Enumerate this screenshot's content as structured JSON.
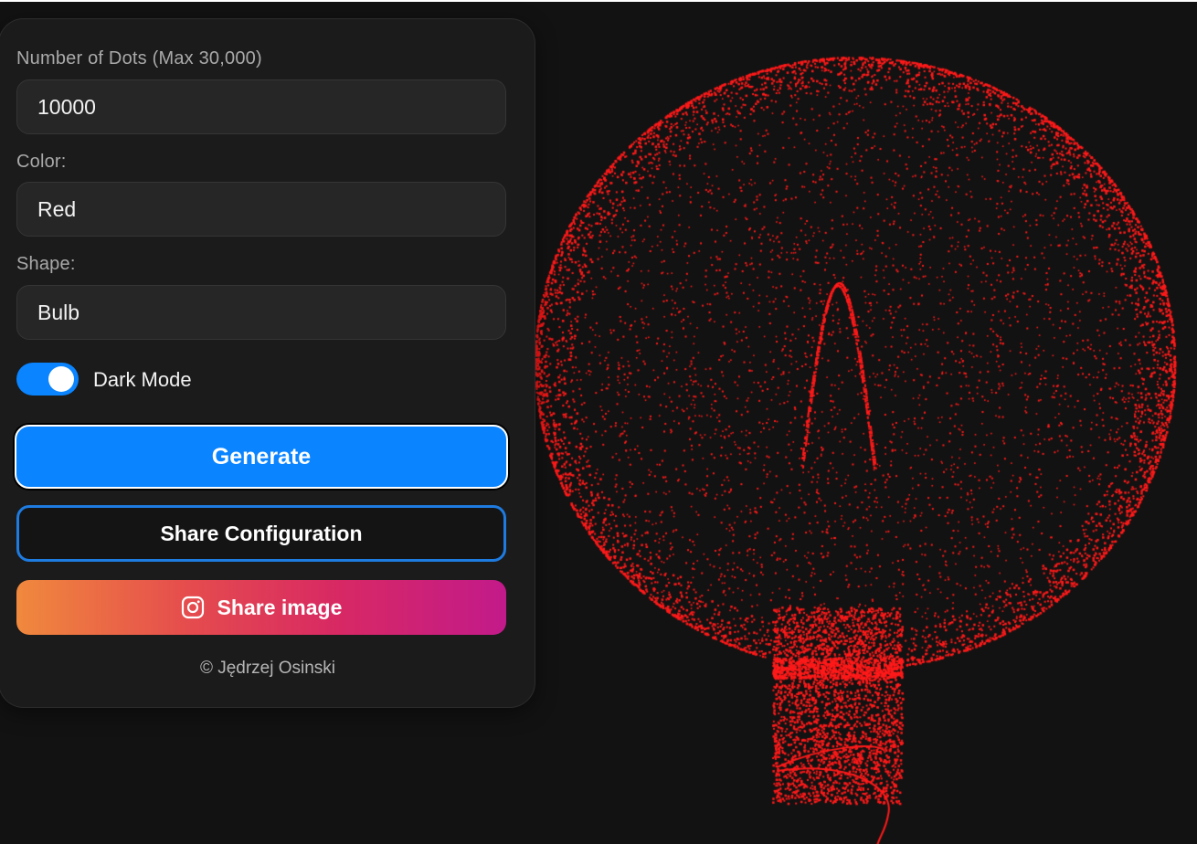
{
  "form": {
    "dots_label": "Number of Dots (Max 30,000)",
    "dots_value": "10000",
    "color_label": "Color:",
    "color_value": "Red",
    "shape_label": "Shape:",
    "shape_value": "Bulb"
  },
  "toggle": {
    "label": "Dark Mode",
    "checked": true
  },
  "buttons": {
    "generate": "Generate",
    "share_config": "Share Configuration",
    "share_image": "Share image",
    "share_image_icon": "instagram-icon"
  },
  "footer": {
    "copyright": "© Jędrzej Osinski"
  },
  "colors": {
    "accent": "#0a84ff",
    "dot": "#ff1a1a",
    "background": "#121212"
  }
}
